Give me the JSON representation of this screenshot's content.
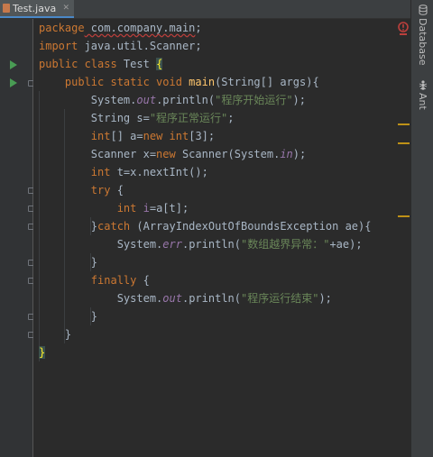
{
  "tab": {
    "label": "Test.java",
    "close": "✕"
  },
  "sidebar": {
    "database": "Database",
    "ant": "Ant"
  },
  "code": {
    "l1": [
      "package",
      " com.company.main",
      ";"
    ],
    "l2": [
      "import",
      " java.util.Scanner;"
    ],
    "l3": [
      "public class",
      " Test ",
      "{"
    ],
    "l4": [
      "    public static void ",
      "main",
      "(String[] args){"
    ],
    "l5": [
      "        System.",
      "out",
      ".println(",
      "\"程序开始运行\"",
      ");"
    ],
    "l6": [
      "        String s=",
      "\"程序正常运行\"",
      ";"
    ],
    "l7": [
      "        ",
      "int",
      "[] ",
      "a",
      "=",
      "new int",
      "[3];"
    ],
    "l8": [
      "        Scanner x=",
      "new",
      " Scanner(System.",
      "in",
      ");"
    ],
    "l9": [
      "        ",
      "int",
      " t=x.nextInt();"
    ],
    "l10": [
      "        ",
      "try",
      " {"
    ],
    "l11": [
      "            ",
      "int ",
      "i",
      "=a[t];"
    ],
    "l12": [
      "        }",
      "catch",
      " (ArrayIndexOutOfBoundsException ae){"
    ],
    "l13": [
      "            System.",
      "err",
      ".println(",
      "\"数组越界异常：\"",
      "+ae);"
    ],
    "l14": [
      "        }"
    ],
    "l15": [
      "        ",
      "finally",
      " {"
    ],
    "l16": [
      "            System.",
      "out",
      ".println(",
      "\"程序运行结束\"",
      ");"
    ],
    "l17": [
      "        }"
    ],
    "l18": [
      "    }"
    ],
    "l19": [
      "}"
    ]
  },
  "colors": {
    "keyword": "#cc7832",
    "string": "#6a8759",
    "field": "#9876aa",
    "method": "#ffc66d",
    "warning_mark": "#be9117",
    "error": "#bc3f3c"
  }
}
